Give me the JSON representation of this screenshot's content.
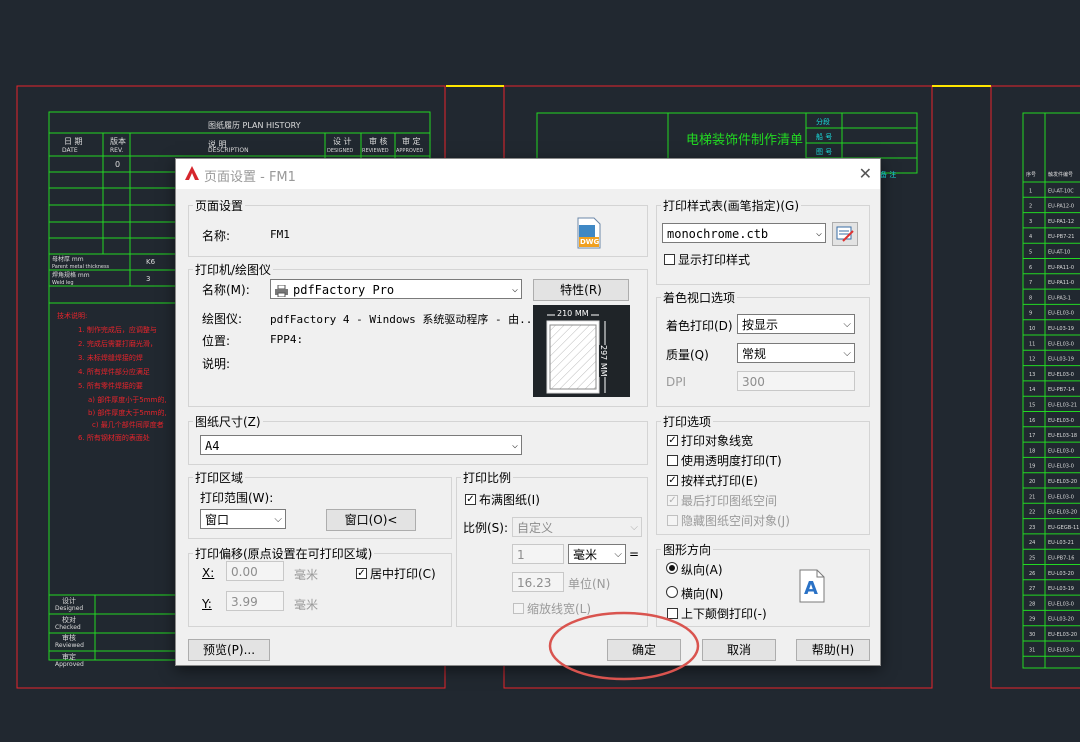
{
  "cad": {
    "plan_history_title": "图纸履历 PLAN HISTORY",
    "col_date_cn": "日 期",
    "col_date_en": "DATE",
    "col_rev_cn": "版本",
    "col_rev_en": "REV.",
    "col_desc_cn": "说 明",
    "col_desc_en": "DESCRIPTION",
    "col_designed_cn": "设 计",
    "col_designed_en": "DESIGNED",
    "col_reviewed_cn": "审 核",
    "col_reviewed_en": "REVIEWED",
    "col_approved_cn": "审 定",
    "col_approved_en": "APPROVED",
    "rev_0": "0",
    "thickness_label": "母材厚 mm",
    "thickness_label_en": "Parent metal thickness",
    "weld_label": "焊角规格 mm",
    "weld_label_en": "Weld leg",
    "val_k6": "K6",
    "val_3": "3",
    "tech_note": "技术说明:",
    "note_1": "1. 制作完成后，应调整与",
    "note_2": "2. 完成后需要打磨光滑，",
    "note_3": "3. 未标焊缝焊接的焊",
    "note_4": "4. 所有焊件部分应满足",
    "note_5": "5. 所有零件焊接的要",
    "note_5a": "a) 部件厚度小于5mm的,",
    "note_5b": "b) 部件厚度大于5mm的,",
    "note_5c": "c) 最几个部件同厚度者",
    "note_6": "6. 所有钢材面的表面处",
    "sign_designed": "设计",
    "sign_designed_en": "Designed",
    "sign_checked": "校对",
    "sign_checked_en": "Checked",
    "sign_reviewed": "审核",
    "sign_reviewed_en": "Reviewed",
    "sign_approved": "审定",
    "sign_approved_en": "Approved",
    "sheet2_title": "电梯装饰件制作清单",
    "sheet2_h1": "分段",
    "sheet2_h2": "船 号",
    "sheet2_h3": "图 号",
    "sheet2_h4": "备 注",
    "sheet3_col1": "序号",
    "sheet3_col2": "触发件编号",
    "sheet3_rows": [
      "1",
      "2",
      "3",
      "4",
      "5",
      "6",
      "7",
      "8",
      "9",
      "10",
      "11",
      "12",
      "13",
      "14",
      "15",
      "16",
      "17",
      "18",
      "19",
      "20",
      "21",
      "22",
      "23",
      "24",
      "25",
      "26",
      "27",
      "28",
      "29",
      "30",
      "31"
    ],
    "sheet3_codes": [
      "EU-AT-10C",
      "EU-PA12-0",
      "EU-PA1-12",
      "EU-PB7-21",
      "EU-AT-10",
      "EU-PA11-0",
      "EU-PA11-0",
      "EU-PA3-1",
      "EU-EL03-0",
      "EU-L03-19",
      "EU-EL03-0",
      "EU-L03-19",
      "EU-EL03-0",
      "EU-PB7-14",
      "EU-EL03-21",
      "EU-EL03-0",
      "EU-EL03-18",
      "EU-EL03-0",
      "EU-EL03-0",
      "EU-EL03-20",
      "EU-EL03-0",
      "EU-EL03-20",
      "EU-GEGB-11",
      "EU-L03-21",
      "EU-PB7-16",
      "EU-L03-20",
      "EU-L03-19",
      "EU-EL03-0",
      "EU-L03-20",
      "EU-EL03-20",
      "EU-EL03-0"
    ]
  },
  "dialog": {
    "title": "页面设置 - FM1",
    "page_setup_group": "页面设置",
    "name_label": "名称:",
    "name_value": "FM1",
    "dwg_icon_text": "DWG",
    "printer_group": "打印机/绘图仪",
    "printer_name_label": "名称(M):",
    "printer_name_value": "pdfFactory Pro",
    "properties_button": "特性(R)",
    "plotter_label": "绘图仪:",
    "plotter_value": "pdfFactory 4 - Windows 系统驱动程序 - 由...",
    "location_label": "位置:",
    "location_value": "FPP4:",
    "description_label": "说明:",
    "preview_width": "210 MM",
    "preview_height": "297 MM",
    "paper_size_group": "图纸尺寸(Z)",
    "paper_size_value": "A4",
    "plot_area_group": "打印区域",
    "plot_range_label": "打印范围(W):",
    "plot_range_value": "窗口",
    "window_button": "窗口(O)<",
    "plot_offset_group": "打印偏移(原点设置在可打印区域)",
    "x_label": "X:",
    "x_value": "0.00",
    "x_unit": "毫米",
    "y_label": "Y:",
    "y_value": "3.99",
    "y_unit": "毫米",
    "center_plot_label": "居中打印(C)",
    "plot_scale_group": "打印比例",
    "fit_to_paper_label": "布满图纸(I)",
    "scale_label": "比例(S):",
    "scale_value": "自定义",
    "scale_num": "1",
    "scale_unit": "毫米",
    "scale_eq": "=",
    "scale_den": "16.23",
    "scale_unit2": "单位(N)",
    "scale_lineweights_label": "缩放线宽(L)",
    "plot_style_group": "打印样式表(画笔指定)(G)",
    "plot_style_value": "monochrome.ctb",
    "display_styles_label": "显示打印样式",
    "shaded_group": "着色视口选项",
    "shade_plot_label": "着色打印(D)",
    "shade_plot_value": "按显示",
    "quality_label": "质量(Q)",
    "quality_value": "常规",
    "dpi_label": "DPI",
    "dpi_value": "300",
    "plot_options_group": "打印选项",
    "opt_lineweights": "打印对象线宽",
    "opt_transparency": "使用透明度打印(T)",
    "opt_plot_styles": "按样式打印(E)",
    "opt_paperspace_last": "最后打印图纸空间",
    "opt_hide_paperspace": "隐藏图纸空间对象(J)",
    "orientation_group": "图形方向",
    "portrait_label": "纵向(A)",
    "landscape_label": "横向(N)",
    "upside_down_label": "上下颠倒打印(-)",
    "orientation_icon_letter": "A",
    "preview_button": "预览(P)...",
    "ok_button": "确定",
    "cancel_button": "取消",
    "help_button": "帮助(H)"
  },
  "colors": {
    "cad_green": "#22d822",
    "cad_red": "#e8242b",
    "cad_yellow": "#ffe600",
    "cad_cyan": "#19e0e0",
    "highlight_circle": "#d9544f"
  }
}
